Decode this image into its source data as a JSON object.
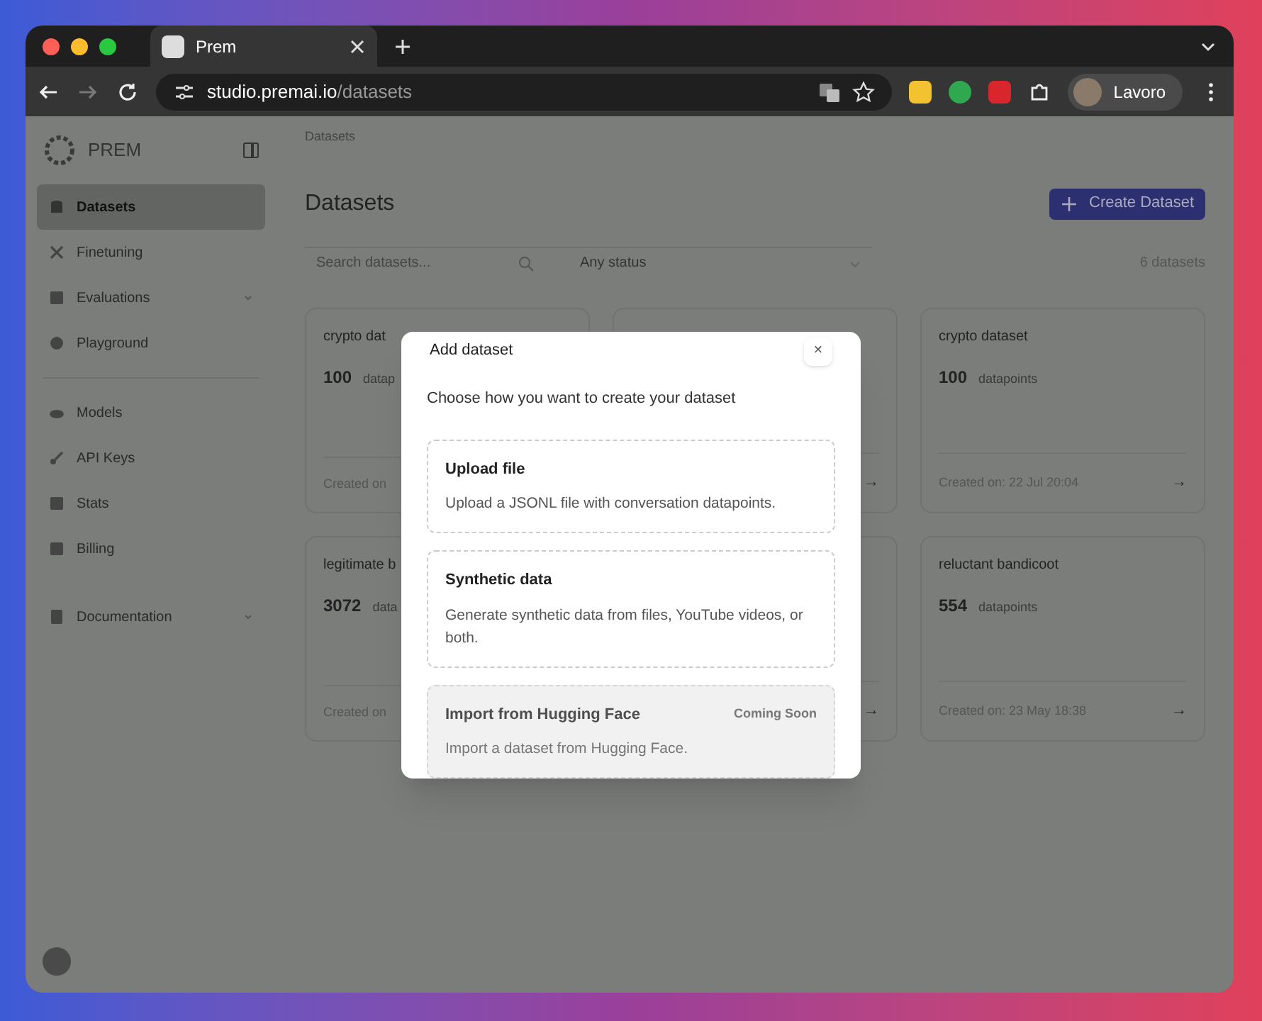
{
  "browser": {
    "tab": {
      "title": "Prem",
      "selected": true
    },
    "url": {
      "host": "studio.premai.io",
      "path": "/datasets"
    },
    "profile": "Lavoro"
  },
  "sidebar": {
    "brand": "PREM",
    "groups": [
      [
        {
          "label": "Datasets",
          "selected": true
        },
        {
          "label": "Finetuning",
          "selected": false
        },
        {
          "label": "Evaluations",
          "selected": false,
          "chevron": true
        },
        {
          "label": "Playground",
          "selected": false
        }
      ],
      [
        {
          "label": "Models",
          "selected": false
        },
        {
          "label": "API Keys",
          "selected": false
        },
        {
          "label": "Stats",
          "selected": false
        },
        {
          "label": "Billing",
          "selected": false
        }
      ],
      [
        {
          "label": "Documentation",
          "selected": false,
          "chevron": true
        }
      ]
    ]
  },
  "main": {
    "breadcrumb": "Datasets",
    "title": "Datasets",
    "create_button": "Create Dataset",
    "search": {
      "placeholder": "Search datasets..."
    },
    "status_filter": "Any status",
    "count": "6 datasets",
    "cards": [
      {
        "name": "crypto dat",
        "count": "100",
        "unit": "datap",
        "created": "Created on"
      },
      {
        "arrow": "→"
      },
      {
        "name": "crypto dataset",
        "count": "100",
        "unit": "datapoints",
        "created": "Created on: 22 Jul 20:04",
        "arrow": "→"
      },
      {
        "name": "legitimate b",
        "count": "3072",
        "unit": "data",
        "created": "Created on"
      },
      {
        "arrow": "→"
      },
      {
        "name": "reluctant bandicoot",
        "count": "554",
        "unit": "datapoints",
        "created": "Created on: 23 May 18:38",
        "arrow": "→"
      }
    ]
  },
  "dialog": {
    "title": "Add dataset",
    "close": "×",
    "prompt": "Choose how you want to create your dataset",
    "options": [
      {
        "title": "Upload file",
        "description": "Upload a JSONL file with conversation datapoints.",
        "disabled": false
      },
      {
        "title": "Synthetic data",
        "description": "Generate synthetic data from files, YouTube videos, or both.",
        "disabled": false
      },
      {
        "title": "Import from Hugging Face",
        "description": "Import a dataset from Hugging Face.",
        "badge": "Coming Soon",
        "disabled": true
      }
    ]
  }
}
